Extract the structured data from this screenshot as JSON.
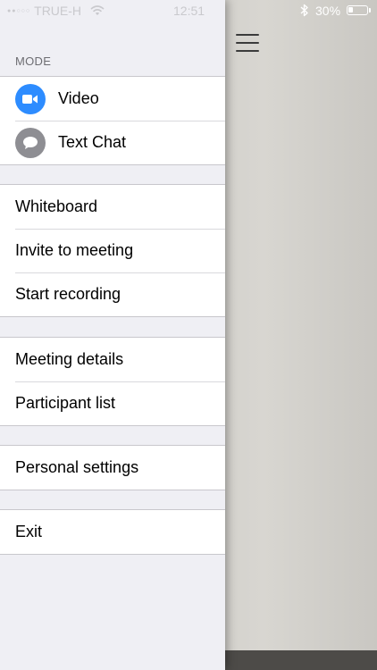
{
  "status_bar": {
    "carrier": "TRUE-H",
    "time": "12:51",
    "battery_percent": "30%",
    "battery_level": 0.3
  },
  "mode_section": {
    "header": "MODE",
    "items": [
      {
        "label": "Video",
        "icon": "video-camera-icon",
        "color": "#2d8cff"
      },
      {
        "label": "Text Chat",
        "icon": "chat-bubble-icon",
        "color": "#8e8e93"
      }
    ]
  },
  "meeting_tools": {
    "items": [
      {
        "label": "Whiteboard"
      },
      {
        "label": "Invite to meeting"
      },
      {
        "label": "Start recording"
      }
    ]
  },
  "meeting_info": {
    "items": [
      {
        "label": "Meeting details"
      },
      {
        "label": "Participant list"
      }
    ]
  },
  "settings": {
    "items": [
      {
        "label": "Personal settings"
      }
    ]
  },
  "exit": {
    "items": [
      {
        "label": "Exit"
      }
    ]
  }
}
